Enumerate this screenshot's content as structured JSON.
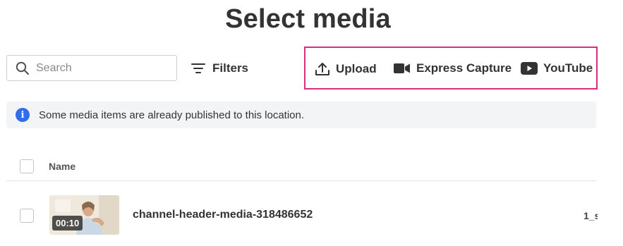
{
  "page": {
    "title": "Select media"
  },
  "toolbar": {
    "search_placeholder": "Search",
    "filters_label": "Filters",
    "actions": {
      "upload_label": "Upload",
      "express_capture_label": "Express Capture",
      "youtube_label": "YouTube"
    },
    "highlight_color": "#d6307d"
  },
  "notice": {
    "text": "Some media items are already published to this location.",
    "icon": "info-icon",
    "icon_color": "#2f6ee8"
  },
  "table": {
    "columns": {
      "name": "Name"
    },
    "rows": [
      {
        "duration": "00:10",
        "name": "channel-header-media-318486652",
        "extra": "1_s"
      }
    ]
  }
}
